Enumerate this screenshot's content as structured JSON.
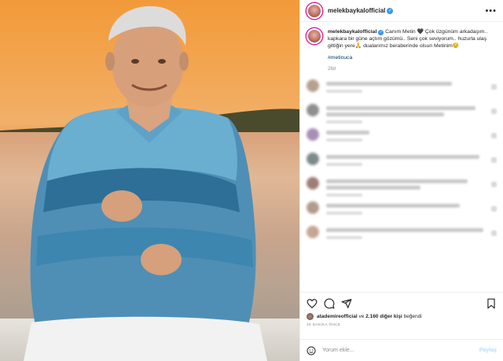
{
  "post": {
    "username": "melekbaykalofficial",
    "caption_username": "melekbaykalofficial",
    "caption_text": "Canım Metin 🖤 Çok üzgünüm arkadaşım.. kapkara bir güne açtım gözümü.. Seni çok seviyorum.. huzurla ulaş gittiğin yere🙏 dualarımız beraberinde olsun Metinim😔",
    "hashtag": "#metinuca",
    "age": "28d"
  },
  "likes": {
    "prefix": "atademireofficial",
    "middle": " ve ",
    "count": "2.160 diğer kişi",
    "suffix": " beğendi"
  },
  "time_ago": "28 DAKİKA ÖNCE",
  "comment_input": {
    "placeholder": "Yorum ekle...",
    "post_label": "Paylaş"
  },
  "icons": {
    "like": "heart-icon",
    "comment": "comment-icon",
    "share": "share-icon",
    "save": "bookmark-icon",
    "emoji": "emoji-icon",
    "more": "more-icon"
  },
  "colors": {
    "link": "#00376b",
    "verified": "#3897f0",
    "muted": "#8e8e8e"
  }
}
